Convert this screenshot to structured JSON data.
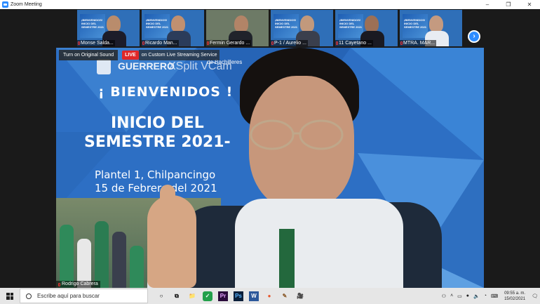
{
  "window": {
    "title": "Zoom Meeting"
  },
  "window_controls": {
    "minimize": "–",
    "maximize": "❐",
    "close": "✕"
  },
  "gallery": {
    "participants": [
      {
        "name": "Monse Salda..."
      },
      {
        "name": "Ricardo Man..."
      },
      {
        "name": "Fermin Gerardo ..."
      },
      {
        "name": "P-1 / Aurelio ..."
      },
      {
        "name": "11 Cayetano ..."
      },
      {
        "name": "MTRA. MAR..."
      }
    ],
    "next_icon": "›"
  },
  "stream": {
    "original_sound": "Turn on Original Sound",
    "live_label": "LIVE",
    "custom_label": "on Custom Live Streaming Service"
  },
  "slide": {
    "brand": "GUERRERO",
    "watermark": "XSplit VCam",
    "bachillerato": "de Bachilleres",
    "welcome": "¡ BIENVENIDOS !",
    "line1": "INICIO DEL",
    "line2": "SEMESTRE 2021-",
    "place": "Plantel 1, Chilpancingo",
    "date": "15 de Febrero del 2021"
  },
  "speaker": {
    "name": "Rodrigo Cabrera"
  },
  "taskbar": {
    "search_placeholder": "Escribe aquí para buscar",
    "apps": [
      "○",
      "⧉",
      "📁",
      "✓",
      "Pr",
      "Ps",
      "W",
      "●",
      "✎",
      "🎥"
    ],
    "time": "09:55 a. m.",
    "date": "15/02/2021"
  },
  "colors": {
    "zoom_blue": "#2d8cff",
    "live_red": "#e02828",
    "slide_blue": "#2d6fc4"
  }
}
